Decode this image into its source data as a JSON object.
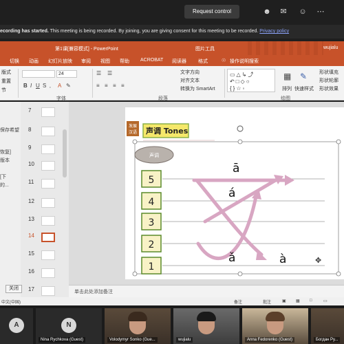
{
  "teams": {
    "request_control": "Request control",
    "banner_bold": "ecording has started.",
    "banner_text": " This meeting is being recorded. By joining, you are giving consent for this meeting to be recorded. ",
    "banner_link": "Privacy policy"
  },
  "powerpoint": {
    "title": "第1课[兼容模式] - PowerPoint",
    "picture_tools": "图片工具",
    "user": "wujialu",
    "tabs": [
      "切换",
      "动画",
      "幻灯片放映",
      "审阅",
      "视图",
      "帮助",
      "ACROBAT",
      "阅读器",
      "格式"
    ],
    "tell_me": "操作说明搜索",
    "ribbon": {
      "font_group": "字体",
      "paragraph_group": "段落",
      "drawing_group": "绘图",
      "font_size": "24",
      "text_direction": "文字方向",
      "align_text": "对齐文本",
      "convert_smartart": "转换为 SmartArt",
      "arrange": "排列",
      "quick_styles": "快速样式",
      "shape_fill": "形状填充",
      "shape_outline": "形状轮廓",
      "shape_effects": "形状效果",
      "left_labels": [
        "版式",
        "重置",
        "节"
      ]
    },
    "left_strip": [
      "保存希望",
      "恢复]",
      "版本",
      "[下",
      "的..."
    ],
    "slide_numbers": [
      "7",
      "8",
      "9",
      "10",
      "11",
      "12",
      "13",
      "14",
      "15",
      "16",
      "17"
    ],
    "selected_slide": "14",
    "close": "关闭",
    "notes_placeholder": "单击此处添加备注",
    "status_lang": "中文(中国)",
    "status_notes": "备注",
    "status_comments": "批注"
  },
  "slide": {
    "badge_top": "发展",
    "badge_bottom": "汉语",
    "title": "声调 Tones",
    "oval_label": "声调",
    "levels": [
      "5",
      "4",
      "3",
      "2",
      "1"
    ],
    "tone_marks": [
      "ā",
      "á",
      "ǎ",
      "à"
    ]
  },
  "participants": [
    {
      "initial": "A",
      "name": ""
    },
    {
      "initial": "N",
      "name": "Nina Rychkova (Guest)"
    },
    {
      "initial": "",
      "name": "Volodymyr Sonko (Gue..."
    },
    {
      "initial": "",
      "name": "wujialu"
    },
    {
      "initial": "",
      "name": "Anna Fedorenko (Guest)"
    },
    {
      "initial": "",
      "name": "Богдан Ру..."
    }
  ],
  "colors": {
    "ppt_orange": "#c7522a",
    "level_box_fill": "#f8f2c6",
    "level_box_border": "#5a8a2a",
    "arrow_pink": "#d8a6c2"
  }
}
